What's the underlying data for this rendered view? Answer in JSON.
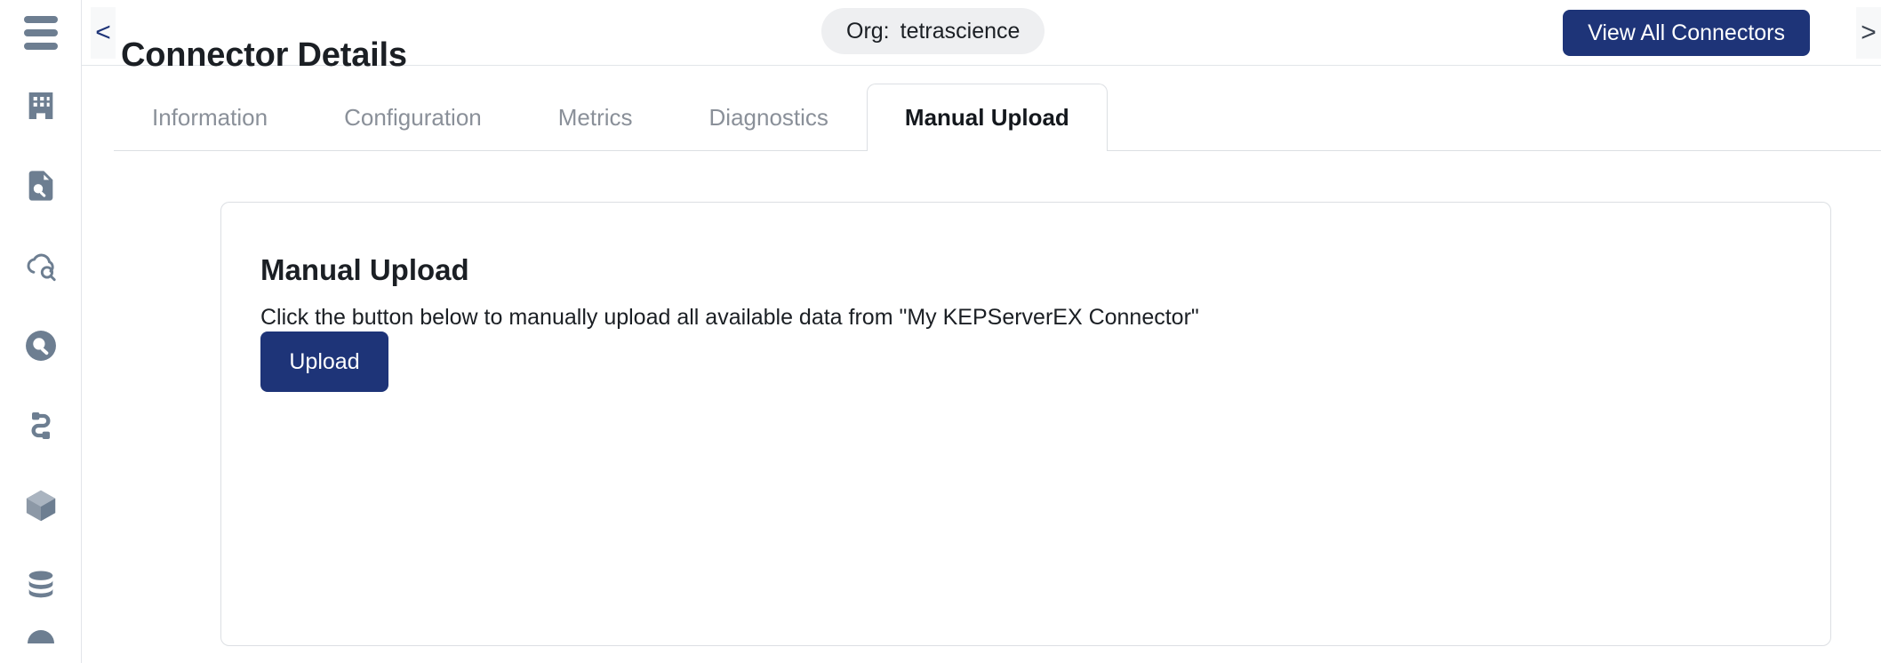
{
  "sidebar": {
    "menu_icon": "hamburger-menu-icon",
    "items": [
      {
        "icon": "building-icon",
        "name": "organization"
      },
      {
        "icon": "document-search-icon",
        "name": "document-search"
      },
      {
        "icon": "cloud-search-icon",
        "name": "cloud-search"
      },
      {
        "icon": "magnifier-circle-icon",
        "name": "search"
      },
      {
        "icon": "pipeline-link-icon",
        "name": "pipelines"
      },
      {
        "icon": "cube-icon",
        "name": "packages"
      },
      {
        "icon": "database-icon",
        "name": "data"
      },
      {
        "icon": "partial-icon",
        "name": "more"
      }
    ]
  },
  "topbar": {
    "back_chevron": "<",
    "forward_chevron": ">",
    "title": "Connector Details",
    "org_label": "Org:",
    "org_value": "tetrascience",
    "view_all_label": "View All Connectors",
    "accent_color": "#1e3478"
  },
  "tabs": {
    "items": [
      {
        "label": "Information",
        "active": false
      },
      {
        "label": "Configuration",
        "active": false
      },
      {
        "label": "Metrics",
        "active": false
      },
      {
        "label": "Diagnostics",
        "active": false
      },
      {
        "label": "Manual Upload",
        "active": true
      }
    ]
  },
  "card": {
    "title": "Manual Upload",
    "description": "Click the button below to manually upload all available data from \"My KEPServerEX Connector\"",
    "upload_label": "Upload"
  }
}
